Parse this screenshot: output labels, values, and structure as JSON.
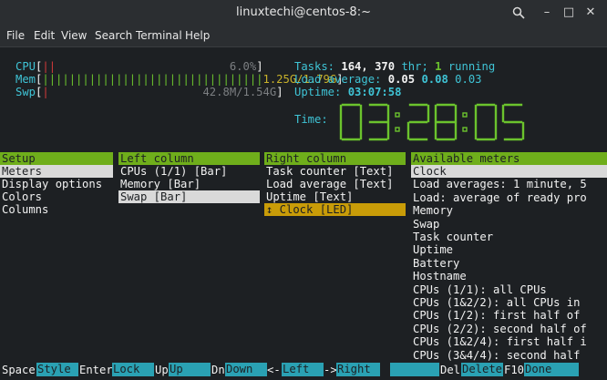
{
  "window": {
    "title": "linuxtechi@centos-8:~",
    "search_icon": "search-icon",
    "minimize": "–",
    "maximize": "□",
    "close": "✕"
  },
  "menu": [
    "File",
    "Edit",
    "View",
    "Search",
    "Terminal",
    "Help"
  ],
  "meters": {
    "cpu": {
      "label": "CPU",
      "value": "6.0%",
      "bars": "||"
    },
    "mem": {
      "label": "Mem",
      "value": "1.25G/1.79G",
      "bars": "|||||||||||||||||||||||||||||||||"
    },
    "swp": {
      "label": "Swp",
      "value": "42.8M/1.54G",
      "bars": "|"
    }
  },
  "tasks": {
    "label": "Tasks:",
    "count": "164,",
    "thr": "370",
    "thr_label": "thr;",
    "running": "1",
    "running_label": "running"
  },
  "load": {
    "label": "Load average:",
    "v1": "0.05",
    "v2": "0.08",
    "v3": "0.03"
  },
  "uptime": {
    "label": "Uptime:",
    "value": "03:07:58"
  },
  "clock": {
    "label": "Time:",
    "digits": [
      "0",
      "3",
      ":",
      "2",
      "8",
      ":",
      "0",
      "5"
    ]
  },
  "setup": {
    "header": "Setup",
    "items": [
      "Meters",
      "Display options",
      "Colors",
      "Columns"
    ]
  },
  "left_column": {
    "header": "Left column",
    "items": [
      "CPUs (1/1) [Bar]",
      "Memory [Bar]",
      "Swap [Bar]"
    ]
  },
  "right_column": {
    "header": "Right column",
    "items": [
      "Task counter [Text]",
      "Load average [Text]",
      "Uptime [Text]",
      "↕ Clock [LED]"
    ]
  },
  "available": {
    "header": "Available meters",
    "items": [
      "Clock",
      "Load averages: 1 minute, 5",
      "Load: average of ready pro",
      "Memory",
      "Swap",
      "Task counter",
      "Uptime",
      "Battery",
      "Hostname",
      "CPUs (1/1): all CPUs",
      "CPUs (1&2/2): all CPUs in",
      "CPUs (1/2): first half of",
      "CPUs (2/2): second half of",
      "CPUs (1&2/4): first half i",
      "CPUs (3&4/4): second half"
    ]
  },
  "footer": [
    {
      "key": "Space",
      "label": "Style"
    },
    {
      "key": "Enter",
      "label": "Lock"
    },
    {
      "key": "Up",
      "label": "Up"
    },
    {
      "key": "Dn",
      "label": "Down"
    },
    {
      "key": "<-",
      "label": "Left"
    },
    {
      "key": "->",
      "label": "Right"
    },
    {
      "key": "Del",
      "label": "Delete"
    },
    {
      "key": "F10",
      "label": "Done"
    }
  ],
  "colors": {
    "header_green": "#6fae1b",
    "cyan": "#3fc4d6",
    "led_green": "#6bc32d",
    "selection_yellow": "#c99c08",
    "footer_cyan": "#2aa1b3"
  }
}
